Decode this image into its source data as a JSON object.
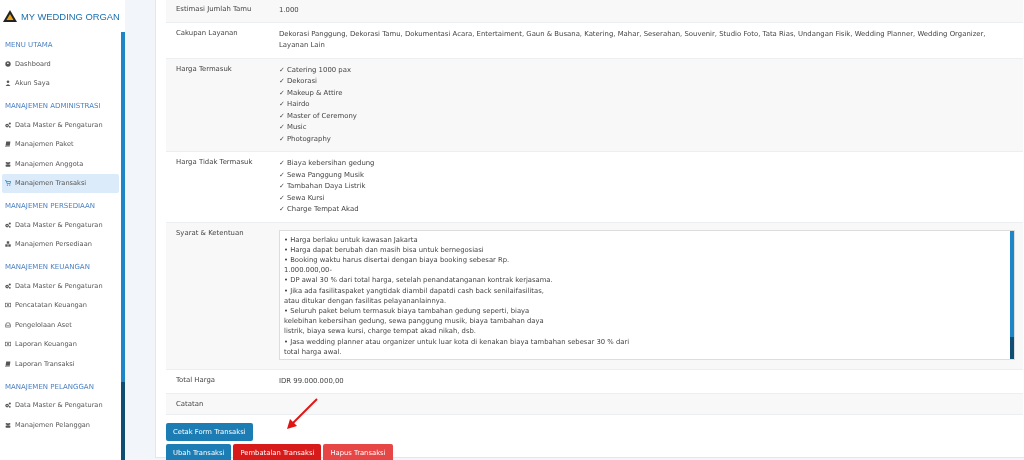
{
  "sidebar": {
    "brand": "MY WEDDING ORGAN",
    "sections": [
      {
        "title": "MENU UTAMA",
        "items": [
          {
            "label": "Dashboard",
            "selected": false
          },
          {
            "label": "Akun Saya",
            "selected": false
          }
        ]
      },
      {
        "title": "MANAJEMEN ADMINISTRASI",
        "items": [
          {
            "label": "Data Master & Pengaturan",
            "selected": false
          },
          {
            "label": "Manajemen Paket",
            "selected": false
          },
          {
            "label": "Manajemen Anggota",
            "selected": false
          },
          {
            "label": "Manajemen Transaksi",
            "selected": true
          }
        ]
      },
      {
        "title": "MANAJEMEN PERSEDIAAN",
        "items": [
          {
            "label": "Data Master & Pengaturan",
            "selected": false
          },
          {
            "label": "Manajemen Persediaan",
            "selected": false
          }
        ]
      },
      {
        "title": "MANAJEMEN KEUANGAN",
        "items": [
          {
            "label": "Data Master & Pengaturan",
            "selected": false
          },
          {
            "label": "Pencatatan Keuangan",
            "selected": false
          },
          {
            "label": "Pengelolaan Aset",
            "selected": false
          },
          {
            "label": "Laporan Keuangan",
            "selected": false
          },
          {
            "label": "Laporan Transaksi",
            "selected": false
          }
        ]
      },
      {
        "title": "MANAJEMEN PELANGGAN",
        "items": [
          {
            "label": "Data Master & Pengaturan",
            "selected": false
          },
          {
            "label": "Manajemen Pelanggan",
            "selected": false
          }
        ]
      }
    ]
  },
  "details": [
    {
      "kind": "text",
      "label": "Estimasi Jumlah Tamu",
      "value": "1.000"
    },
    {
      "kind": "text",
      "label": "Cakupan Layanan",
      "value": "Dekorasi Panggung, Dekorasi Tamu, Dokumentasi Acara, Entertaiment, Gaun & Busana, Katering, Mahar, Seserahan, Souvenir, Studio Foto, Tata Rias, Undangan Fisik, Wedding Planner, Wedding Organizer, Layanan Lain"
    },
    {
      "kind": "list",
      "label": "Harga Termasuk",
      "items": [
        "✓ Catering 1000 pax",
        "✓ Dekorasi",
        "✓ Makeup & Attire",
        "✓ Hairdo",
        "✓ Master of Ceremony",
        "✓ Music",
        "✓ Photography"
      ]
    },
    {
      "kind": "list",
      "label": "Harga Tidak Termasuk",
      "items": [
        "✓ Biaya kebersihan gedung",
        "✓ Sewa Panggung Musik",
        "✓ Tambahan Daya Listrik",
        "✓ Sewa Kursi",
        "✓ Charge Tempat Akad"
      ]
    },
    {
      "kind": "textarea",
      "label": "Syarat & Ketentuan",
      "items": [
        "• Harga berlaku untuk kawasan Jakarta",
        "• Harga dapat berubah dan masih bisa untuk bernegosiasi",
        "• Booking waktu harus disertai dengan biaya booking sebesar Rp.",
        "1.000.000,00-",
        "• DP awal 30 % dari total harga, setelah penandatanganan kontrak kerjasama.",
        "• Jika ada fasilitaspaket yangtidak diambil dapatdi cash back senilaifasilitas,",
        "atau ditukar dengan fasilitas pelayananlainnya.",
        "• Seluruh paket belum termasuk biaya tambahan gedung seperti, biaya",
        "kelebihan kebersihan gedung, sewa panggung musik, biaya tambahan daya",
        "listrik, biaya sewa kursi, charge tempat akad nikah, dsb.",
        "• Jasa wedding planner atau organizer untuk luar kota di kenakan biaya tambahan sebesar 30 % dari",
        "total harga awal."
      ]
    },
    {
      "kind": "text",
      "label": "Total Harga",
      "value": "IDR 99.000.000,00"
    },
    {
      "kind": "text",
      "label": "Catatan"
    }
  ],
  "actions": [
    [
      {
        "label": "Cetak Form Transaksi",
        "kind": "primary"
      }
    ],
    [
      {
        "label": "Ubah Transaksi",
        "kind": "primary"
      },
      {
        "label": "Pembatalan Transaksi",
        "kind": "danger"
      },
      {
        "label": "Hapus Transaksi",
        "kind": "danger-light"
      }
    ]
  ]
}
